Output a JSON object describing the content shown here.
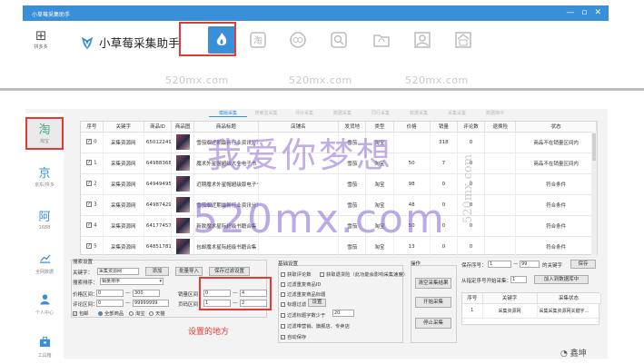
{
  "window": {
    "title": "小草莓采集助手",
    "buttons": [
      "—",
      "▫",
      "✕"
    ]
  },
  "toolbar": {
    "apps_label": "拼多多",
    "app_name": "小草莓采集助手",
    "buttons": [
      "taobao-fire",
      "tao",
      "aliexpress",
      "search",
      "refresh",
      "user",
      "shop"
    ]
  },
  "watermarks": {
    "site": "520mx.com",
    "cn": "我爱你梦想",
    "big": "520mx.com",
    "vertical": "520mx.com"
  },
  "sidebar": [
    {
      "icon": "淘",
      "label": "淘宝"
    },
    {
      "icon": "京",
      "label": "京东/拼多"
    },
    {
      "icon": "阿",
      "label": "1688"
    },
    {
      "icon": "chart",
      "label": "全网数据"
    },
    {
      "icon": "person",
      "label": "个人中心"
    },
    {
      "icon": "box",
      "label": "工具箱"
    }
  ],
  "subtabs": [
    "模版采集",
    "搜索宝采集",
    "评价采集",
    "数据采集",
    "同行采集",
    "数据采集",
    "采集设置",
    "数据库中"
  ],
  "grid": {
    "columns": [
      "序号",
      "关键字",
      "商品ID",
      "商品图",
      "商品标题",
      "店铺名",
      "发货地",
      "类型",
      "价格",
      "销量",
      "评论数",
      "退换险",
      "状态"
    ],
    "rows": [
      {
        "no": "0",
        "kw": "采集资源网",
        "id": "650122498",
        "title": "雪茄烟近期最新行业资讯分享",
        "shop": "",
        "loc": "雪茄",
        "type": "淘宝",
        "price": "",
        "sales": "318",
        "comments": "0",
        "ret": "",
        "status": "商品不在销量区间内"
      },
      {
        "no": "1",
        "kw": "采集资源网",
        "id": "649883683",
        "title": "魔术外星帽超级大全电子书",
        "shop": "",
        "loc": "雪茄",
        "type": "淘宝",
        "price": "50",
        "sales": "7",
        "comments": "0",
        "ret": "",
        "status": "商品不在销量区间内"
      },
      {
        "no": "2",
        "kw": "采集资源网",
        "id": "649494957",
        "title": "近期魔术外星帽超级版电子书",
        "shop": "",
        "loc": "雪茄",
        "type": "淘宝",
        "price": "98",
        "sales": "0",
        "comments": "0",
        "ret": "",
        "status": "符合条件"
      },
      {
        "no": "3",
        "kw": "采集资源网",
        "id": "649874290",
        "title": "雪茄烟近期最新行业资讯分享",
        "shop": "",
        "loc": "雪茄",
        "type": "淘宝",
        "price": "48",
        "sales": "0",
        "comments": "0",
        "ret": "",
        "status": "符合条件"
      },
      {
        "no": "4",
        "kw": "采集资源网",
        "id": "641774571",
        "title": "新款魔术星际超级书籍合集",
        "shop": "",
        "loc": "雪茄",
        "type": "淘宝",
        "price": "50",
        "sales": "0",
        "comments": "0",
        "ret": "",
        "status": "符合条件"
      },
      {
        "no": "5",
        "kw": "采集资源网",
        "id": "648517813",
        "title": "包邮魔术星际超级书籍合集",
        "shop": "",
        "loc": "雪茄",
        "type": "淘宝",
        "price": "13",
        "sales": "0",
        "comments": "0",
        "ret": "",
        "status": "符合条件"
      }
    ]
  },
  "search": {
    "title": "搜索设置",
    "keyword_label": "关键字：",
    "keyword_value": "采集资源网",
    "add_btn": "添加",
    "sort_label": "搜索排序：",
    "sort_value": "销量排序",
    "price_label": "价格区间：",
    "price_min": "0",
    "price_max": "300",
    "comment_label": "评论区间：",
    "comment_min": "0",
    "comment_max": "99999999",
    "opts": [
      "包邮",
      "全部商品",
      "淘宝",
      "天猫"
    ],
    "batch_btn": "批量导入",
    "save_btn": "保存过滤设置",
    "sales_label": "销量区间：",
    "sales_min": "0",
    "sales_max": "4",
    "page_label": "页码区间：",
    "page_min": "1",
    "page_max": "2",
    "hint": "设置的地方"
  },
  "basic": {
    "title": "基础设置",
    "opts": [
      "获取评论数",
      "获取退货险（此功能会影响采集速度）",
      "过滤重复商品ID",
      "过滤重复商品标题",
      "标题过滤",
      "过滤标题字数少于",
      "过滤带营销、旗舰店、专卖店",
      "自动保存"
    ],
    "filter_btn": "设置",
    "word_count": "20"
  },
  "ops": {
    "title": "操作",
    "clear_btn": "清空采集结果",
    "start_btn": "开始采集",
    "stop_btn": "停止采集"
  },
  "save": {
    "range_label": "保存序号：",
    "from": "1",
    "to": "99",
    "suffix": "的关键字",
    "save_btn": "保存",
    "restart_label": "从指定序号开始采集：",
    "restart_value": "1",
    "join_btn": "加入到数据库中"
  },
  "mini": {
    "columns": [
      "序号",
      "关键字",
      "采集状态"
    ],
    "row": {
      "no": "1",
      "kw": "采集资源网",
      "status": "采集采集资源网关键字..."
    }
  },
  "brand_watermark": "鑫坤"
}
